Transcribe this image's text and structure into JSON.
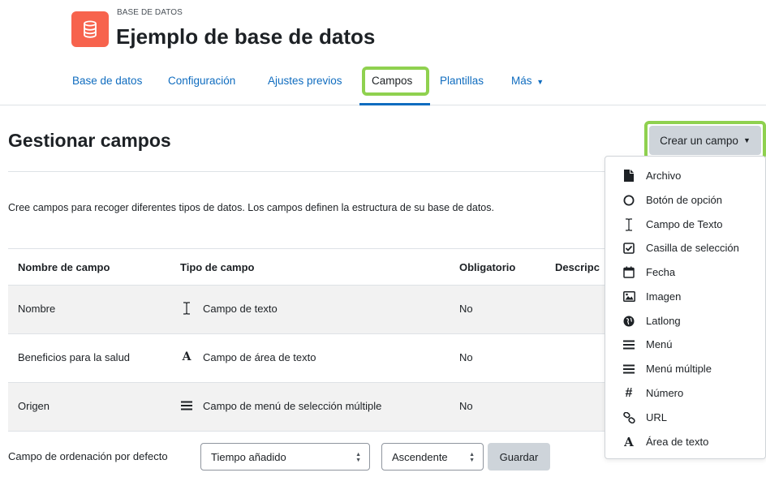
{
  "header": {
    "kicker": "BASE DE DATOS",
    "title": "Ejemplo de base de datos",
    "icon": "database-icon",
    "icon_color": "#f7634d"
  },
  "tabs": [
    {
      "label": "Base de datos"
    },
    {
      "label": "Configuración"
    },
    {
      "label": "Ajustes previos"
    },
    {
      "label": "Campos"
    },
    {
      "label": "Plantillas"
    },
    {
      "label": "Más"
    }
  ],
  "highlight_color": "#8fd14f",
  "link_color": "#0f6cbf",
  "page": {
    "heading": "Gestionar campos",
    "intro": "Cree campos para recoger diferentes tipos de datos. Los campos definen la estructura de su base de datos.",
    "create_button": "Crear un campo"
  },
  "table": {
    "headers": [
      "Nombre de campo",
      "Tipo de campo",
      "Obligatorio",
      "Descripc"
    ],
    "rows": [
      {
        "name": "Nombre",
        "type_icon": "text-cursor-icon",
        "type": "Campo de texto",
        "required": "No"
      },
      {
        "name": "Beneficios para la salud",
        "type_icon": "textarea-icon",
        "type": "Campo de área de texto",
        "required": "No"
      },
      {
        "name": "Origen",
        "type_icon": "menu-icon",
        "type": "Campo de menú de selección múltiple",
        "required": "No"
      }
    ]
  },
  "sort": {
    "label": "Campo de ordenación por defecto",
    "field_value": "Tiempo añadido",
    "order_value": "Ascendente",
    "save": "Guardar"
  },
  "dropdown": {
    "items": [
      {
        "label": "Archivo",
        "icon": "file-icon"
      },
      {
        "label": "Botón de opción",
        "icon": "radio-icon"
      },
      {
        "label": "Campo de Texto",
        "icon": "text-cursor-icon"
      },
      {
        "label": "Casilla de selección",
        "icon": "checkbox-icon"
      },
      {
        "label": "Fecha",
        "icon": "calendar-icon"
      },
      {
        "label": "Imagen",
        "icon": "image-icon"
      },
      {
        "label": "Latlong",
        "icon": "globe-icon"
      },
      {
        "label": "Menú",
        "icon": "menu-icon"
      },
      {
        "label": "Menú múltiple",
        "icon": "menu-icon"
      },
      {
        "label": "Número",
        "icon": "hash-icon"
      },
      {
        "label": "URL",
        "icon": "link-icon"
      },
      {
        "label": "Área de texto",
        "icon": "textarea-icon"
      }
    ]
  }
}
